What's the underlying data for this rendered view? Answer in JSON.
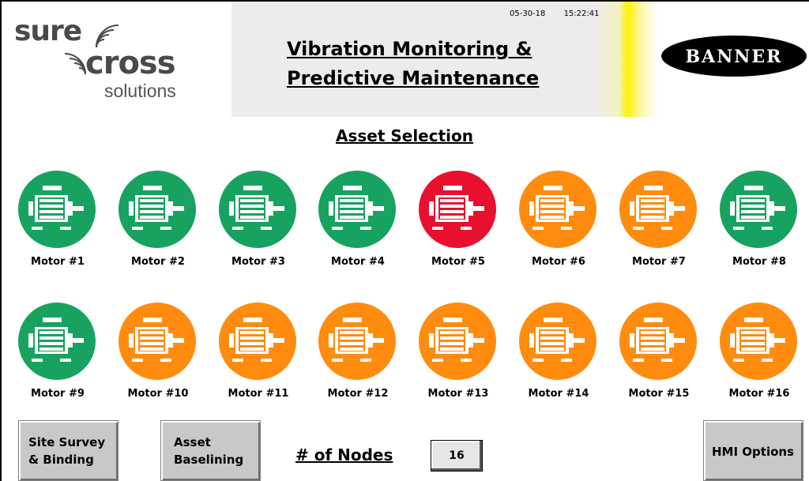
{
  "logos": {
    "surecross_line1": "sure",
    "surecross_line2": "cross",
    "surecross_line3": "solutions",
    "banner": "BANNER"
  },
  "header": {
    "date": "05-30-18",
    "time": "15:22:41",
    "title_line1": "Vibration Monitoring &",
    "title_line2": "Predictive Maintenance"
  },
  "section_title": "Asset Selection",
  "motor_icon": "motor-icon",
  "status_colors": {
    "ok": "#17a35f",
    "alarm": "#e8102e",
    "warning": "#ff8c0f"
  },
  "motors": [
    {
      "label": "Motor #1",
      "status": "ok"
    },
    {
      "label": "Motor #2",
      "status": "ok"
    },
    {
      "label": "Motor #3",
      "status": "ok"
    },
    {
      "label": "Motor #4",
      "status": "ok"
    },
    {
      "label": "Motor #5",
      "status": "alarm"
    },
    {
      "label": "Motor #6",
      "status": "warning"
    },
    {
      "label": "Motor #7",
      "status": "warning"
    },
    {
      "label": "Motor #8",
      "status": "ok"
    },
    {
      "label": "Motor #9",
      "status": "ok"
    },
    {
      "label": "Motor #10",
      "status": "warning"
    },
    {
      "label": "Motor #11",
      "status": "warning"
    },
    {
      "label": "Motor #12",
      "status": "warning"
    },
    {
      "label": "Motor #13",
      "status": "warning"
    },
    {
      "label": "Motor #14",
      "status": "warning"
    },
    {
      "label": "Motor #15",
      "status": "warning"
    },
    {
      "label": "Motor #16",
      "status": "warning"
    }
  ],
  "controls": {
    "site_survey_line1": "Site Survey",
    "site_survey_line2": "& Binding",
    "asset_baselining_line1": "Asset",
    "asset_baselining_line2": "Baselining",
    "nodes_label": "# of Nodes",
    "nodes_value": "16",
    "hmi_options": "HMI Options"
  }
}
